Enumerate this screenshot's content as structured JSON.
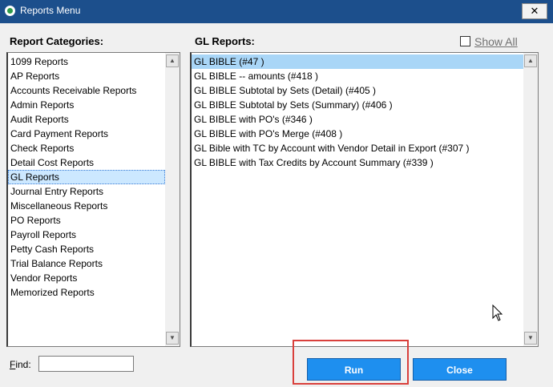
{
  "window": {
    "title": "Reports Menu",
    "close_symbol": "✕"
  },
  "categories": {
    "label": "Report Categories:",
    "items": [
      {
        "label": "1099 Reports"
      },
      {
        "label": "AP Reports"
      },
      {
        "label": "Accounts Receivable Reports"
      },
      {
        "label": "Admin Reports"
      },
      {
        "label": "Audit Reports"
      },
      {
        "label": "Card Payment Reports"
      },
      {
        "label": "Check Reports"
      },
      {
        "label": "Detail Cost Reports"
      },
      {
        "label": "GL Reports",
        "selected": true
      },
      {
        "label": "Journal Entry Reports"
      },
      {
        "label": "Miscellaneous Reports"
      },
      {
        "label": "PO Reports"
      },
      {
        "label": "Payroll Reports"
      },
      {
        "label": "Petty Cash Reports"
      },
      {
        "label": "Trial Balance Reports"
      },
      {
        "label": "Vendor Reports"
      },
      {
        "label": "Memorized Reports"
      }
    ]
  },
  "gl_reports": {
    "label": "GL Reports:",
    "show_all": {
      "label": "Show All",
      "checked": false
    },
    "items": [
      {
        "label": "GL BIBLE (#47 )",
        "selected": true
      },
      {
        "label": "GL BIBLE -- amounts (#418 )"
      },
      {
        "label": "GL BIBLE Subtotal by Sets (Detail) (#405 )"
      },
      {
        "label": "GL BIBLE Subtotal by Sets (Summary) (#406 )"
      },
      {
        "label": "GL BIBLE with PO's (#346 )"
      },
      {
        "label": "GL BIBLE with PO's Merge (#408 )"
      },
      {
        "label": "GL Bible with TC by Account with Vendor Detail in Export (#307 )"
      },
      {
        "label": "GL BIBLE with Tax Credits by Account Summary (#339 )"
      }
    ]
  },
  "find": {
    "label": "Find:",
    "value": ""
  },
  "buttons": {
    "run": "Run",
    "close": "Close"
  },
  "colors": {
    "titlebar": "#1c4f8c",
    "button": "#1e8fef",
    "selection": "#a9d6f7",
    "highlight_box": "#d9403c"
  }
}
